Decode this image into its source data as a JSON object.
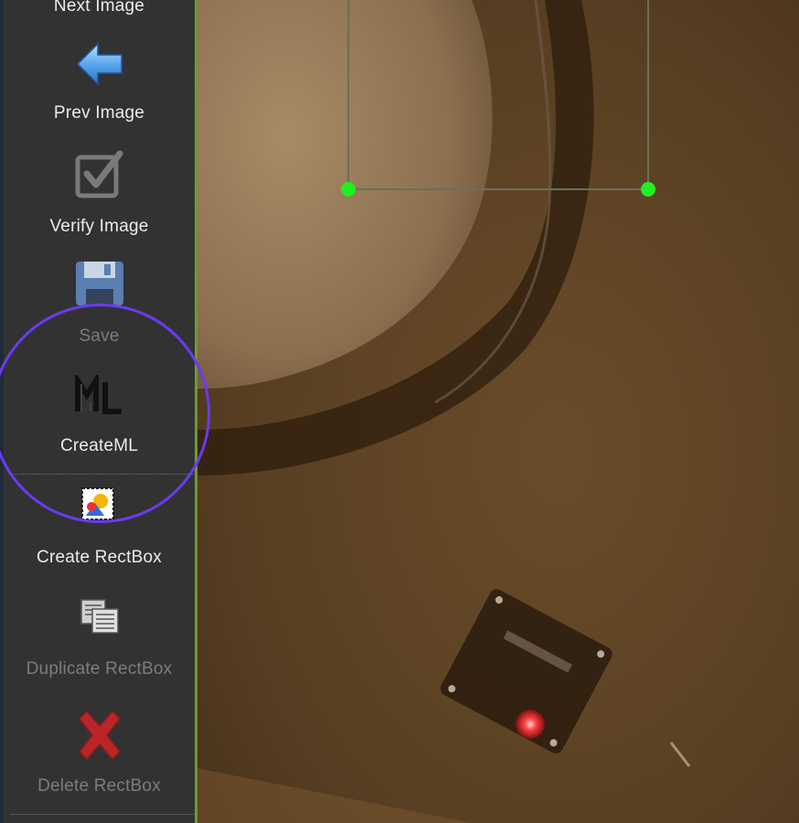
{
  "toolbar": {
    "items": [
      {
        "label": "Next Image",
        "icon": "next-arrow-icon",
        "enabled": true
      },
      {
        "label": "Prev Image",
        "icon": "prev-arrow-icon",
        "enabled": true
      },
      {
        "label": "Verify Image",
        "icon": "verify-checkbox-icon",
        "enabled": true
      },
      {
        "label": "Save",
        "icon": "floppy-disk-icon",
        "enabled": false
      },
      {
        "label": "CreateML",
        "icon": "createml-icon",
        "enabled": true
      },
      {
        "label": "Create RectBox",
        "icon": "create-rectbox-icon",
        "enabled": true
      },
      {
        "label": "Duplicate RectBox",
        "icon": "duplicate-rectbox-icon",
        "enabled": false
      },
      {
        "label": "Delete RectBox",
        "icon": "delete-x-icon",
        "enabled": false
      }
    ]
  },
  "colors": {
    "toolbar_bg": "#323233",
    "accent_divider": "#6e9a2e",
    "annotation_handle": "#22ee22",
    "highlight_ring": "#6b3bf0"
  }
}
